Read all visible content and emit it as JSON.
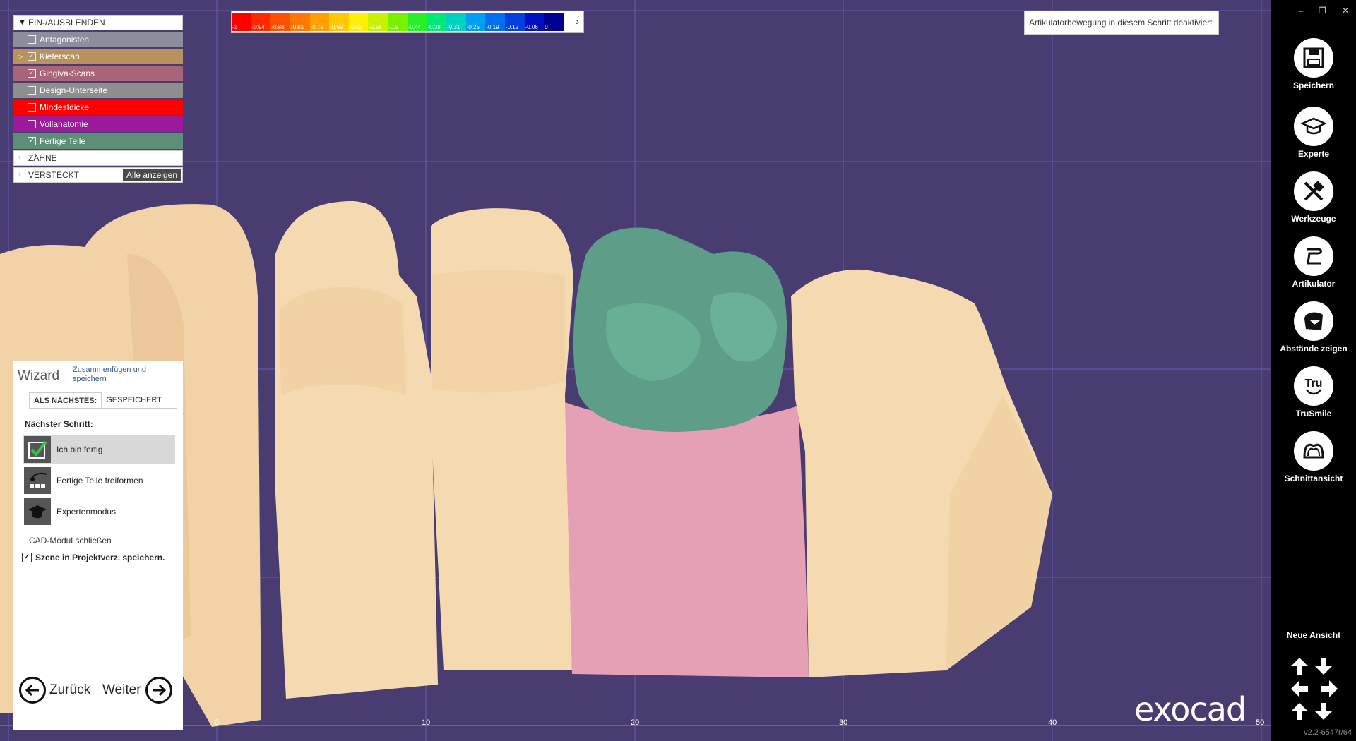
{
  "layers": {
    "header": "EIN-/AUSBLENDEN",
    "items": [
      {
        "label": "Antagonisten",
        "checked": false,
        "color": "#8c8e9e",
        "expandable": false
      },
      {
        "label": "Kieferscan",
        "checked": true,
        "color": "#b8925f",
        "expandable": true
      },
      {
        "label": "Gingiva-Scans",
        "checked": true,
        "color": "#a86478",
        "expandable": false
      },
      {
        "label": "Design-Unterseite",
        "checked": false,
        "color": "#8e8e8e",
        "expandable": false
      },
      {
        "label": "Mindestdicke",
        "checked": false,
        "color": "#ff0000",
        "expandable": false
      },
      {
        "label": "Vollanatomie",
        "checked": false,
        "color": "#9a1a9a",
        "expandable": false
      },
      {
        "label": "Fertige Teile",
        "checked": true,
        "color": "#5e8e78",
        "expandable": false
      }
    ],
    "teeth_section": "ZÄHNE",
    "hidden_section": "VERSTECKT",
    "show_all_label": "Alle anzeigen"
  },
  "color_scale": {
    "labels": [
      "-1",
      "-0.94",
      "-0.88",
      "-0.81",
      "-0.75",
      "-0.69",
      "-0.62",
      "-0.56",
      "-0.5",
      "-0.44",
      "-0.38",
      "-0.31",
      "-0.25",
      "-0.19",
      "-0.12",
      "-0.06",
      "0"
    ],
    "colors": [
      "#ff0000",
      "#ff2800",
      "#ff5000",
      "#ff7800",
      "#ffa000",
      "#ffc800",
      "#fff000",
      "#c8f000",
      "#78f000",
      "#28f028",
      "#00e878",
      "#00d0c0",
      "#00a0f0",
      "#0070f0",
      "#0040e0",
      "#0010c0",
      "#000090"
    ]
  },
  "articulator_notice": "Artikulatorbewegung in diesem Schritt deaktiviert",
  "wizard": {
    "title": "Wizard",
    "subtitle": "Zusammenfügen und speichern",
    "tab_next": "ALS NÄCHSTES:",
    "tab_saved": "GESPEICHERT",
    "next_step_label": "Nächster Schritt:",
    "steps": [
      {
        "label": "Ich bin fertig",
        "icon": "checkmark-icon",
        "selected": true
      },
      {
        "label": "Fertige Teile freiformen",
        "icon": "freeform-icon",
        "selected": false
      },
      {
        "label": "Expertenmodus",
        "icon": "graduation-cap-icon",
        "selected": false
      }
    ],
    "close_cad": "CAD-Modul schließen",
    "save_scene": "Szene in Projektverz. speichern.",
    "save_scene_checked": true,
    "back": "Zurück",
    "next": "Weiter"
  },
  "toolbar": {
    "tools": [
      {
        "label": "Speichern",
        "icon": "save-icon"
      },
      {
        "label": "Experte",
        "icon": "graduation-cap-icon"
      },
      {
        "label": "Werkzeuge",
        "icon": "tools-icon"
      },
      {
        "label": "Artikulator",
        "icon": "articulator-icon"
      },
      {
        "label": "Abstände zeigen",
        "icon": "distance-icon"
      },
      {
        "label": "TruSmile",
        "icon": "trusmile-icon"
      },
      {
        "label": "Schnittansicht",
        "icon": "section-view-icon"
      }
    ],
    "new_view": "Neue Ansicht",
    "version": "v2.2-6547r/64"
  },
  "ruler": {
    "ticks": [
      "0",
      "10",
      "20",
      "30",
      "40",
      "50"
    ]
  },
  "brand": "exocad"
}
